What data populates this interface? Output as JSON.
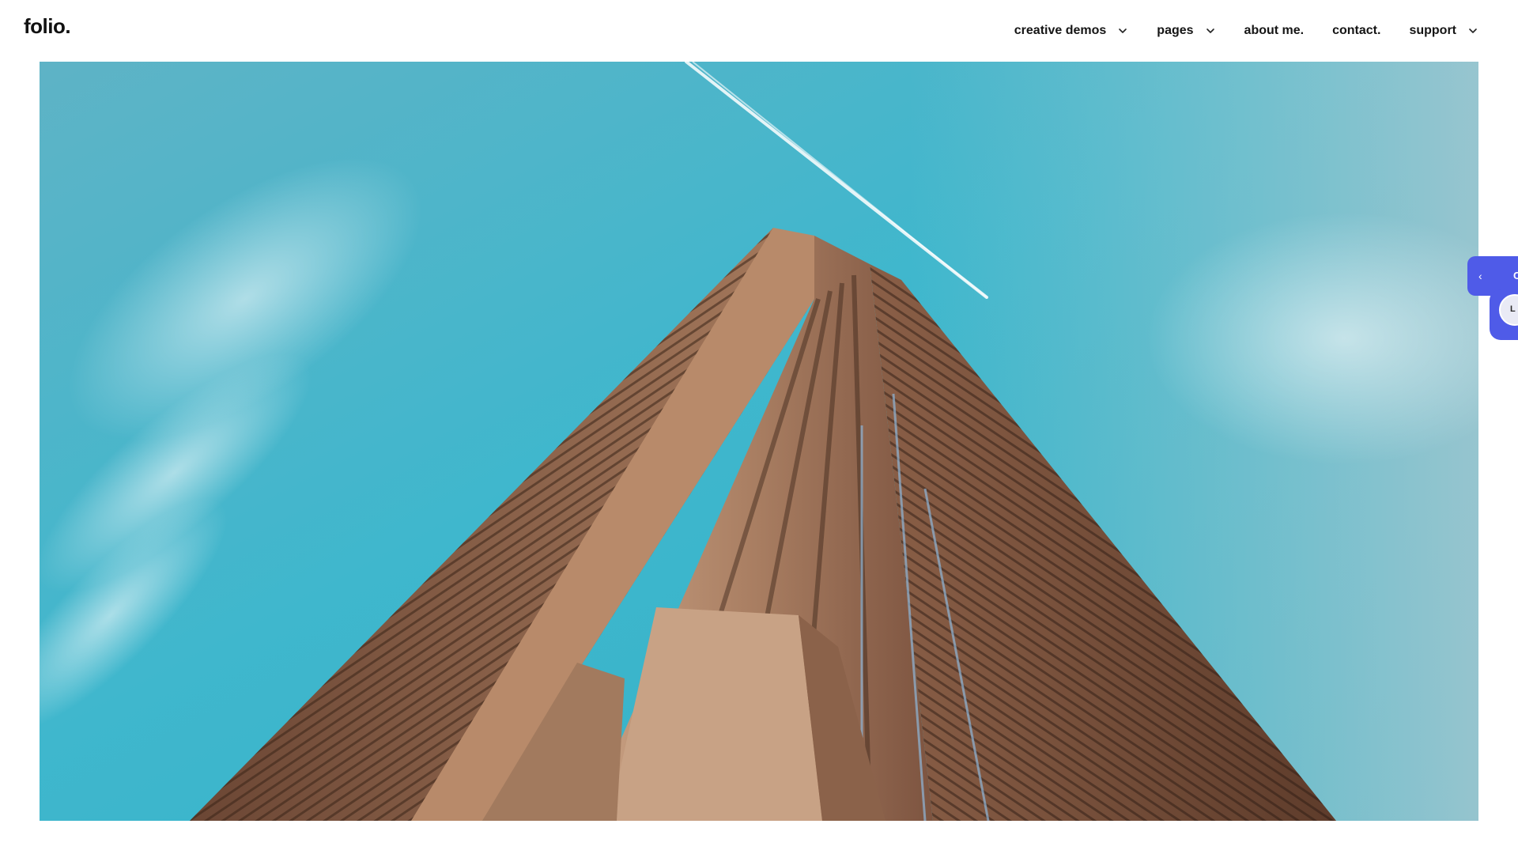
{
  "header": {
    "logo": "folio.",
    "nav": [
      {
        "label": "creative demos",
        "has_dropdown": true
      },
      {
        "label": "pages",
        "has_dropdown": true
      },
      {
        "label": "about me.",
        "has_dropdown": false
      },
      {
        "label": "contact.",
        "has_dropdown": false
      },
      {
        "label": "support",
        "has_dropdown": true
      }
    ]
  },
  "hero": {
    "image": "skyscraper-looking-up-blue-sky-with-contrail"
  },
  "side_widget": {
    "chevron": "‹",
    "tab_text": "C",
    "avatar_text": "L",
    "accent": "#4f5be8"
  },
  "colors": {
    "sky_top": "#4db6c9",
    "sky_light": "#8fc6cc",
    "building_light": "#c39a7a",
    "building_dark": "#5b3a26",
    "accent": "#4f5be8"
  }
}
